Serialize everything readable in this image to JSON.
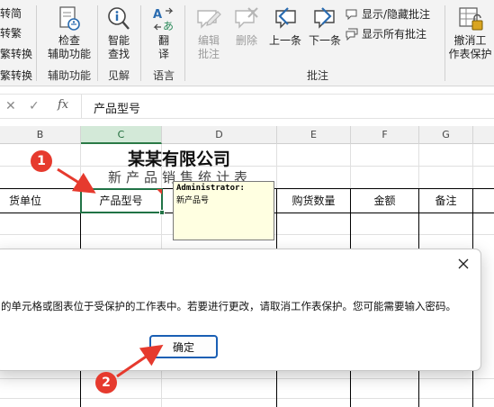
{
  "ribbon": {
    "left_fragments": [
      "转简",
      "转繁",
      "繁转换",
      "繁转换"
    ],
    "left_group_label": "",
    "buttons": {
      "check_helper": "检查\n辅助功能",
      "smart_lookup": "智能\n查找",
      "translate": "翻\n译",
      "edit_comment": "编辑\n批注",
      "delete_comment": "删除",
      "prev_comment": "上一条",
      "next_comment": "下一条",
      "unprotect_sheet": "撤消工\n作表保护"
    },
    "small_buttons": {
      "show_hide_comment": "显示/隐藏批注",
      "show_all_comments": "显示所有批注"
    },
    "groups": {
      "accessibility": "辅助功能",
      "insights": "见解",
      "language": "语言",
      "comments": "批注"
    }
  },
  "formula_bar": {
    "cancel_icon": "✕",
    "enter_icon": "✓",
    "fx_label": "fx",
    "value": "产品型号"
  },
  "sheet": {
    "columns": [
      "B",
      "C",
      "D",
      "E",
      "F",
      "G"
    ],
    "active_column": "C",
    "title": "某某有限公司",
    "subtitle": "新产品销售统计表",
    "headers": {
      "unit": "货单位",
      "model": "产品型号",
      "purchase_qty": "购货数量",
      "amount": "金额",
      "remark": "备注"
    },
    "comment": {
      "author": "Administrator:",
      "text": "新产品号"
    }
  },
  "dialog": {
    "message": "的单元格或图表位于受保护的工作表中。若要进行更改，请取消工作表保护。您可能需要输入密码。",
    "ok_label": "确定",
    "close_icon": "close-icon"
  },
  "annotations": {
    "badge1": "1",
    "badge2": "2",
    "color": "#e63a2e"
  },
  "colors": {
    "excel_green": "#217346",
    "ribbon_bg": "#f3f3f3",
    "comment_bg": "#ffffe1",
    "button_border": "#1a5fb4"
  }
}
